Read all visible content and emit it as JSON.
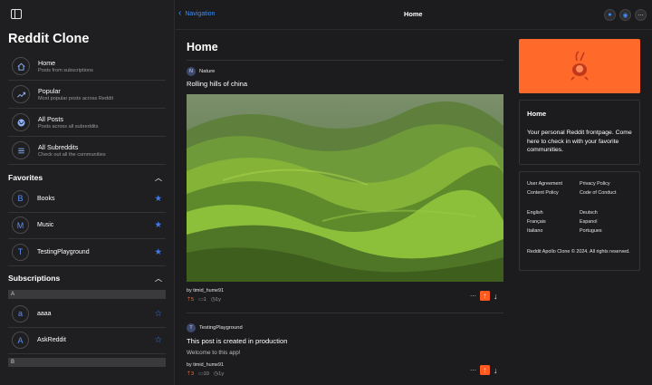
{
  "sidebar": {
    "app_title": "Reddit Clone",
    "nav": [
      {
        "label": "Home",
        "sub": "Posts from subscriptions",
        "icon": "home-icon"
      },
      {
        "label": "Popular",
        "sub": "Most popular posts across Reddit",
        "icon": "trending-icon"
      },
      {
        "label": "All Posts",
        "sub": "Posts across all subreddits",
        "icon": "globe-icon"
      },
      {
        "label": "All Subreddits",
        "sub": "Check out all the communities",
        "icon": "list-icon"
      }
    ],
    "favorites_title": "Favorites",
    "favorites": [
      {
        "letter": "B",
        "label": "Books"
      },
      {
        "letter": "M",
        "label": "Music"
      },
      {
        "letter": "T",
        "label": "TestingPlayground"
      }
    ],
    "subscriptions_title": "Subscriptions",
    "sub_group_a": "A",
    "subscriptions": [
      {
        "letter": "a",
        "label": "aaaa"
      },
      {
        "letter": "A",
        "label": "AskReddit"
      }
    ],
    "sub_group_b": "B"
  },
  "topbar": {
    "back_label": "Navigation",
    "title": "Home",
    "icons": [
      "reddit-icon",
      "account-icon",
      "more-icon"
    ]
  },
  "feed": {
    "page_title": "Home",
    "posts": [
      {
        "subreddit_letter": "N",
        "subreddit": "Nature",
        "title": "Rolling hills of china",
        "author": "by timid_hume91",
        "upvotes": "5",
        "comments": "1",
        "age": "1y"
      },
      {
        "subreddit_letter": "T",
        "subreddit": "TestingPlayground",
        "title": "This post is created in production",
        "body": "Welcome to this app!",
        "author": "by timid_hume91",
        "upvotes": "3",
        "comments": "10",
        "age": "1y"
      }
    ]
  },
  "right": {
    "card_title": "Home",
    "card_text": "Your personal Reddit frontpage. Come here to check in with your favorite communities.",
    "links": [
      "User Agreement",
      "Privacy Policy",
      "Content Policy",
      "Code of Conduct"
    ],
    "languages": [
      "English",
      "Deutsch",
      "Français",
      "Espanol",
      "Italiano",
      "Portugues"
    ],
    "copyright": "Reddit Apollo Clone © 2024. All rights reserved."
  },
  "colors": {
    "accent_blue": "#3d8cf5",
    "upvote_orange": "#ff5a1f",
    "banner_orange": "#ff6a2a"
  }
}
